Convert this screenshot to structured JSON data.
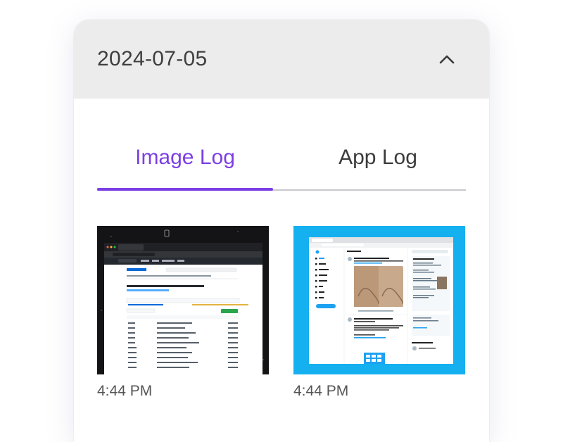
{
  "header": {
    "date": "2024-07-05",
    "collapse_icon": "chevron-up-icon"
  },
  "tabs": [
    {
      "label": "Image Log",
      "active": true
    },
    {
      "label": "App Log",
      "active": false
    }
  ],
  "entries": [
    {
      "time": "4:44 PM",
      "thumbnail": "github-repository-screenshot"
    },
    {
      "time": "4:44 PM",
      "thumbnail": "twitter-timeline-screenshot"
    }
  ],
  "colors": {
    "accent": "#7b3fe4",
    "header_bg": "#ececec",
    "thumb_dark_bg": "#141417",
    "thumb_blue_bg": "#14b0ef"
  }
}
